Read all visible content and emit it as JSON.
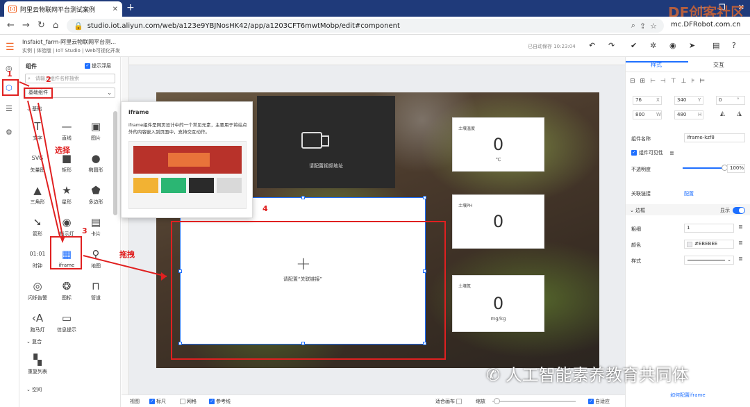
{
  "browser": {
    "tab_title": "阿里云物联网平台测试案例",
    "url": "studio.iot.aliyun.com/web/a123e9YBJNosHK42/app/a1203CFT6mwtMobp/edit#component",
    "new_tab": "+",
    "right_text": "mc.DFRobot.com.cn"
  },
  "header": {
    "project": "Insfaiot_farm-阿里云物联网平台测…",
    "breadcrumb": "实例 | 体验版 | IoT Studio | Web可视化开发",
    "saved": "已自动保存 10:23:04"
  },
  "panel": {
    "title": "组件",
    "show_floating": "提示浮层",
    "search_placeholder": "请输入组件名称搜索",
    "category": "基础组件",
    "section_basic": "基础",
    "section_composite": "复合",
    "section_space": "空间",
    "components": [
      {
        "label": "文字",
        "icon": "T"
      },
      {
        "label": "直线",
        "icon": "—"
      },
      {
        "label": "图片",
        "icon": "▣"
      },
      {
        "label": "矢量图",
        "icon": "SVG"
      },
      {
        "label": "矩形",
        "icon": "■"
      },
      {
        "label": "椭圆形",
        "icon": "●"
      },
      {
        "label": "三角形",
        "icon": "▲"
      },
      {
        "label": "星形",
        "icon": "★"
      },
      {
        "label": "多边形",
        "icon": "⬟"
      },
      {
        "label": "箭形",
        "icon": "➘"
      },
      {
        "label": "指示灯",
        "icon": "◉"
      },
      {
        "label": "卡片",
        "icon": "▤"
      },
      {
        "label": "时钟",
        "icon": "01:01"
      },
      {
        "label": "iframe",
        "icon": "▦"
      },
      {
        "label": "地图",
        "icon": "⚲"
      },
      {
        "label": "闪烁告警",
        "icon": "◎"
      },
      {
        "label": "图标",
        "icon": "❂"
      },
      {
        "label": "管道",
        "icon": "⊓"
      },
      {
        "label": "跑马灯",
        "icon": "‹A"
      },
      {
        "label": "信息提示",
        "icon": "▭"
      }
    ],
    "composite": [
      {
        "label": "重复列表",
        "icon": "▚"
      }
    ]
  },
  "annotations": {
    "n1": "1",
    "n2": "2",
    "n3": "3",
    "n4": "4",
    "select": "选择",
    "drag": "拖拽"
  },
  "tooltip": {
    "title": "iframe",
    "desc": "iframe组件是网页设计中的一个常见元素，主要用于将站点外的内容嵌入到页面中，支持交互动作。"
  },
  "canvas": {
    "video_text": "请配置视频地址",
    "iframe_text": "请配置“关联链接”",
    "gauges": [
      {
        "title": "土壤温度",
        "value": "0",
        "unit": "℃"
      },
      {
        "title": "土壤PH",
        "value": "0",
        "unit": ""
      },
      {
        "title": "土壤氮",
        "value": "0",
        "unit": "mg/kg"
      }
    ]
  },
  "right": {
    "tab_style": "样式",
    "tab_interact": "交互",
    "x": "76",
    "x_lbl": "X",
    "y": "340",
    "y_lbl": "Y",
    "rot": "0",
    "rot_lbl": "°",
    "w": "800",
    "w_lbl": "W",
    "h": "480",
    "h_lbl": "H",
    "name_lbl": "组件名称",
    "name": "iframe-kzf8",
    "visible": "组件可见性",
    "opacity_lbl": "不透明度",
    "opacity": "100%",
    "link_lbl": "关联链接",
    "link_action": "配置",
    "border_lbl": "边框",
    "border_show": "显示",
    "thickness_lbl": "粗细",
    "thickness": "1",
    "color_lbl": "颜色",
    "color": "#EBEBEE",
    "style_lbl": "样式",
    "help": "如何配置iframe"
  },
  "bottom": {
    "view": "视图",
    "ruler": "标尺",
    "grid": "网格",
    "guide": "参考线",
    "fit": "适合画布",
    "zoom": "缩放",
    "adapt": "自适应"
  },
  "watermark": "人工智能素养教育共同体",
  "dfwatermark": "DF创客社区",
  "colors": {
    "accent": "#1e6fff",
    "annotation": "#e02020",
    "brand": "#f26322"
  }
}
